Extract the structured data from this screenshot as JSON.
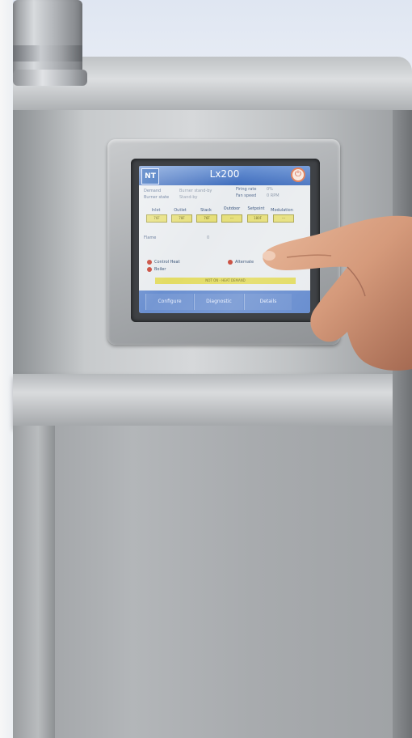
{
  "screen": {
    "title": "Lx200",
    "logo": "NT",
    "demand_label": "Demand",
    "demand_value": "Burner stand-by",
    "burner_state_label": "Burner state",
    "burner_state_value": "Stand-by",
    "firing_rate_label": "Firing rate",
    "firing_rate_value": "0%",
    "fan_speed_label": "Fan speed",
    "fan_speed_value": "0 RPM",
    "temp_labels": [
      "Inlet",
      "Outlet",
      "Stack",
      "Outdoor",
      "Setpoint",
      "Modulation"
    ],
    "temp_values": [
      "76F",
      "78F",
      "76F",
      "---",
      "180F",
      "---"
    ],
    "flame_label": "Flame",
    "flame_value": "0",
    "indicators": [
      "Control Heat",
      "Boiler",
      "Alternate"
    ],
    "banner": "NOT ON - HEAT DEMAND",
    "tabs": [
      "Configure",
      "Diagnostic",
      "Details"
    ]
  }
}
